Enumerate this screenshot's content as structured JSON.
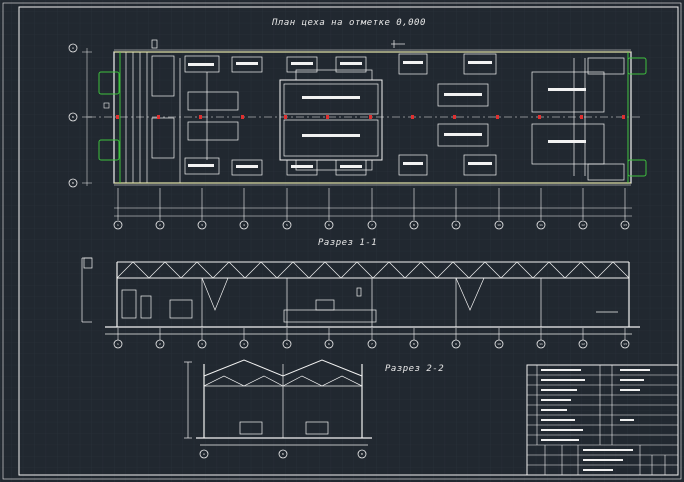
{
  "titles": {
    "plan": "План цеха на отметке 0,000",
    "section1": "Разрез 1-1",
    "section2": "Разрез 2-2"
  },
  "colors": {
    "background": "#212830",
    "grid": "#2b333c",
    "lines": "#f2f2f2",
    "green": "#3ec13e",
    "red": "#e03030",
    "yellow": "#d8d84a"
  },
  "plan_axes_bottom": [
    "1",
    "2",
    "3",
    "4",
    "5",
    "6",
    "7",
    "8",
    "9",
    "10",
    "11",
    "12",
    "13"
  ],
  "plan_axes_left": [
    "А",
    "Б",
    "В"
  ],
  "section_axes": [
    "1",
    "2",
    "3",
    "4",
    "5",
    "6",
    "7",
    "8",
    "9",
    "10",
    "11",
    "12",
    "13"
  ],
  "section2_axes": [
    "А",
    "Б",
    "В"
  ]
}
